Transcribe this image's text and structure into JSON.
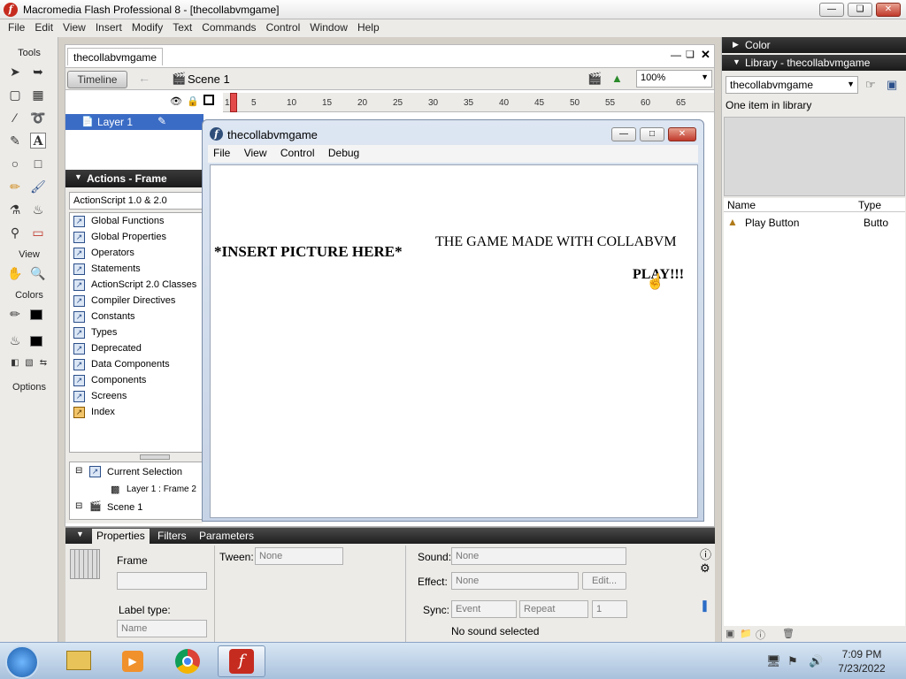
{
  "window": {
    "title": "Macromedia Flash Professional 8 - [thecollabvmgame]"
  },
  "menu": [
    "File",
    "Edit",
    "View",
    "Insert",
    "Modify",
    "Text",
    "Commands",
    "Control",
    "Window",
    "Help"
  ],
  "tools": {
    "label_tools": "Tools",
    "label_view": "View",
    "label_colors": "Colors",
    "label_options": "Options"
  },
  "document": {
    "tab": "thecollabvmgame",
    "timeline_button": "Timeline",
    "scene": "Scene 1",
    "zoom": "100%",
    "ruler": [
      "1",
      "5",
      "10",
      "15",
      "20",
      "25",
      "30",
      "35",
      "40",
      "45",
      "50",
      "55",
      "60",
      "65"
    ],
    "layer": "Layer 1"
  },
  "actions": {
    "header": "Actions - Frame",
    "version": "ActionScript 1.0 & 2.0",
    "items": [
      "Global Functions",
      "Global Properties",
      "Operators",
      "Statements",
      "ActionScript 2.0 Classes",
      "Compiler Directives",
      "Constants",
      "Types",
      "Deprecated",
      "Data Components",
      "Components",
      "Screens",
      "Index"
    ],
    "tree": {
      "current": "Current Selection",
      "frame": "Layer 1 : Frame 2",
      "scene": "Scene 1"
    }
  },
  "player": {
    "title": "thecollabvmgame",
    "menu": [
      "File",
      "View",
      "Control",
      "Debug"
    ],
    "insert_text": "*INSERT PICTURE HERE*",
    "heading": "THE GAME MADE WITH COLLABVM",
    "play": "PLAY!!!"
  },
  "properties": {
    "tabs": [
      "Properties",
      "Filters",
      "Parameters"
    ],
    "frame_label": "Frame",
    "tween_label": "Tween:",
    "tween_value": "None",
    "sound_label": "Sound:",
    "sound_value": "None",
    "effect_label": "Effect:",
    "effect_value": "None",
    "edit_button": "Edit...",
    "sync_label": "Sync:",
    "sync_value": "Event",
    "repeat_value": "Repeat",
    "repeat_count": "1",
    "label_type": "Label type:",
    "name_value": "Name",
    "no_sound": "No sound selected"
  },
  "right": {
    "color_header": "Color",
    "library_header": "Library - thecollabvmgame",
    "library_select": "thecollabvmgame",
    "library_info": "One item in library",
    "col_name": "Name",
    "col_type": "Type",
    "item_name": "Play Button",
    "item_type": "Butto"
  },
  "taskbar": {
    "time": "7:09 PM",
    "date": "7/23/2022"
  }
}
